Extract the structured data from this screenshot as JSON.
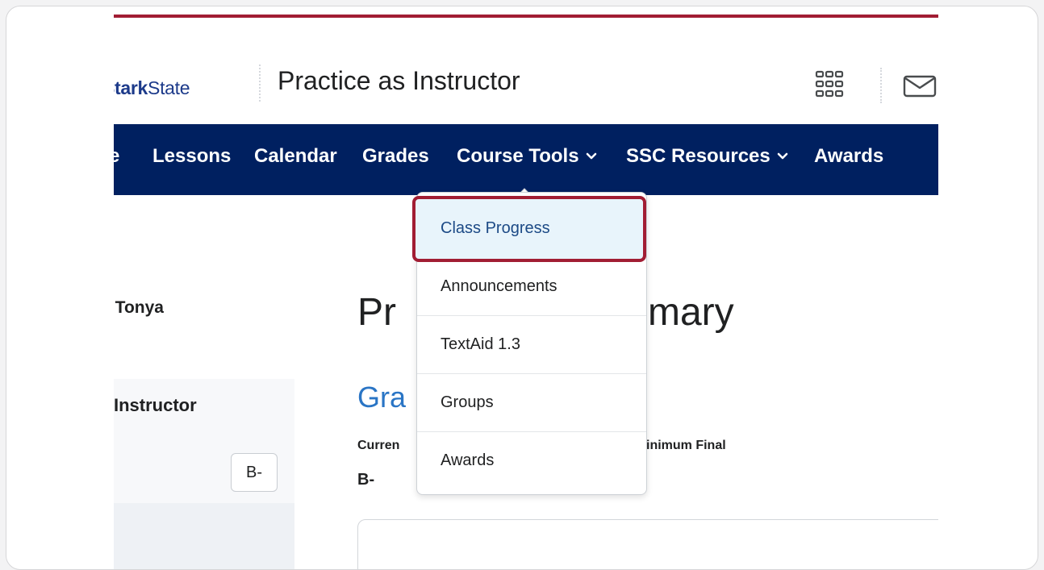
{
  "colors": {
    "accent_bar": "#a11d33",
    "navbar_bg": "#002060",
    "logo_primary": "#1c3a8a",
    "highlight_border": "#a11d33",
    "link_blue": "#2a75c5"
  },
  "header": {
    "logo_bold": "Stark",
    "logo_light": "State",
    "course_title": "Practice as Instructor",
    "apps_icon": "grid-icon",
    "mail_icon": "mail-icon"
  },
  "navbar": {
    "items": [
      {
        "label": "e",
        "has_dropdown": false
      },
      {
        "label": "Lessons",
        "has_dropdown": false
      },
      {
        "label": "Calendar",
        "has_dropdown": false
      },
      {
        "label": "Grades",
        "has_dropdown": false
      },
      {
        "label": "Course Tools",
        "has_dropdown": true
      },
      {
        "label": "SSC Resources",
        "has_dropdown": true
      },
      {
        "label": "Awards",
        "has_dropdown": false
      }
    ]
  },
  "dropdown": {
    "items": [
      {
        "label": "Class Progress",
        "active": true
      },
      {
        "label": "Announcements"
      },
      {
        "label": "TextAid 1.3"
      },
      {
        "label": "Groups"
      },
      {
        "label": "Awards"
      }
    ]
  },
  "left": {
    "user_name": ", Tonya",
    "role_label": "Instructor",
    "grade_value": "B-"
  },
  "main": {
    "heading_left": "Pr",
    "heading_right": "mary",
    "subheading": "Gra",
    "current_label": "Curren",
    "min_final_label": "inimum Final",
    "current_value": "B-"
  }
}
